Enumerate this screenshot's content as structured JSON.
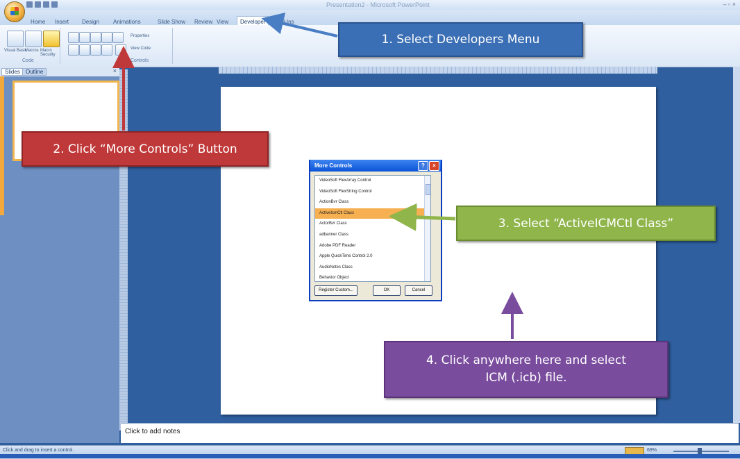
{
  "window": {
    "title": "Presentation2 - Microsoft PowerPoint",
    "quick_access": [
      "save-icon",
      "undo-icon",
      "redo-icon",
      "customize-icon"
    ]
  },
  "ribbon": {
    "tabs": [
      "Home",
      "Insert",
      "Design",
      "Animations",
      "Slide Show",
      "Review",
      "View",
      "Developer",
      "Add-Ins"
    ],
    "active_tab": "Developer",
    "groups": [
      {
        "label": "Code",
        "buttons": [
          "Visual Basic",
          "Macros",
          "Macro Security"
        ]
      },
      {
        "label": "Controls",
        "buttons": [
          "Properties",
          "View Code"
        ]
      }
    ]
  },
  "slides_pane": {
    "tabs": [
      "Slides",
      "Outline"
    ],
    "close": "×"
  },
  "notes": {
    "placeholder": "Click to add notes"
  },
  "status_bar": {
    "text": "Click and drag to insert a control.",
    "zoom": "69%"
  },
  "dialog": {
    "title": "More Controls",
    "help": "?",
    "close": "×",
    "items": [
      "VideoSoft FlexArray Control",
      "VideoSoft FlexString Control",
      "ActionBvr Class",
      "ActiveIcmCtl Class",
      "ActorBvr Class",
      "adbanner Class",
      "Adobe PDF Reader",
      "Apple QuickTime Control 2.0",
      "AudioNotes Class",
      "Behavior Object"
    ],
    "selected_index": 3,
    "buttons": {
      "register": "Register Custom...",
      "ok": "OK",
      "cancel": "Cancel"
    }
  },
  "callouts": {
    "step1": "1. Select Developers Menu",
    "step2": "2. Click “More Controls” Button",
    "step3": "3. Select “ActiveICMCtl Class”",
    "step4": "4. Click anywhere here and select\nICM (.icb) file."
  },
  "colors": {
    "step1": "#3b6fb5",
    "step2": "#c0393a",
    "step3": "#8fb54b",
    "step4": "#7a4c9e",
    "selected_item": "#f6b052"
  }
}
